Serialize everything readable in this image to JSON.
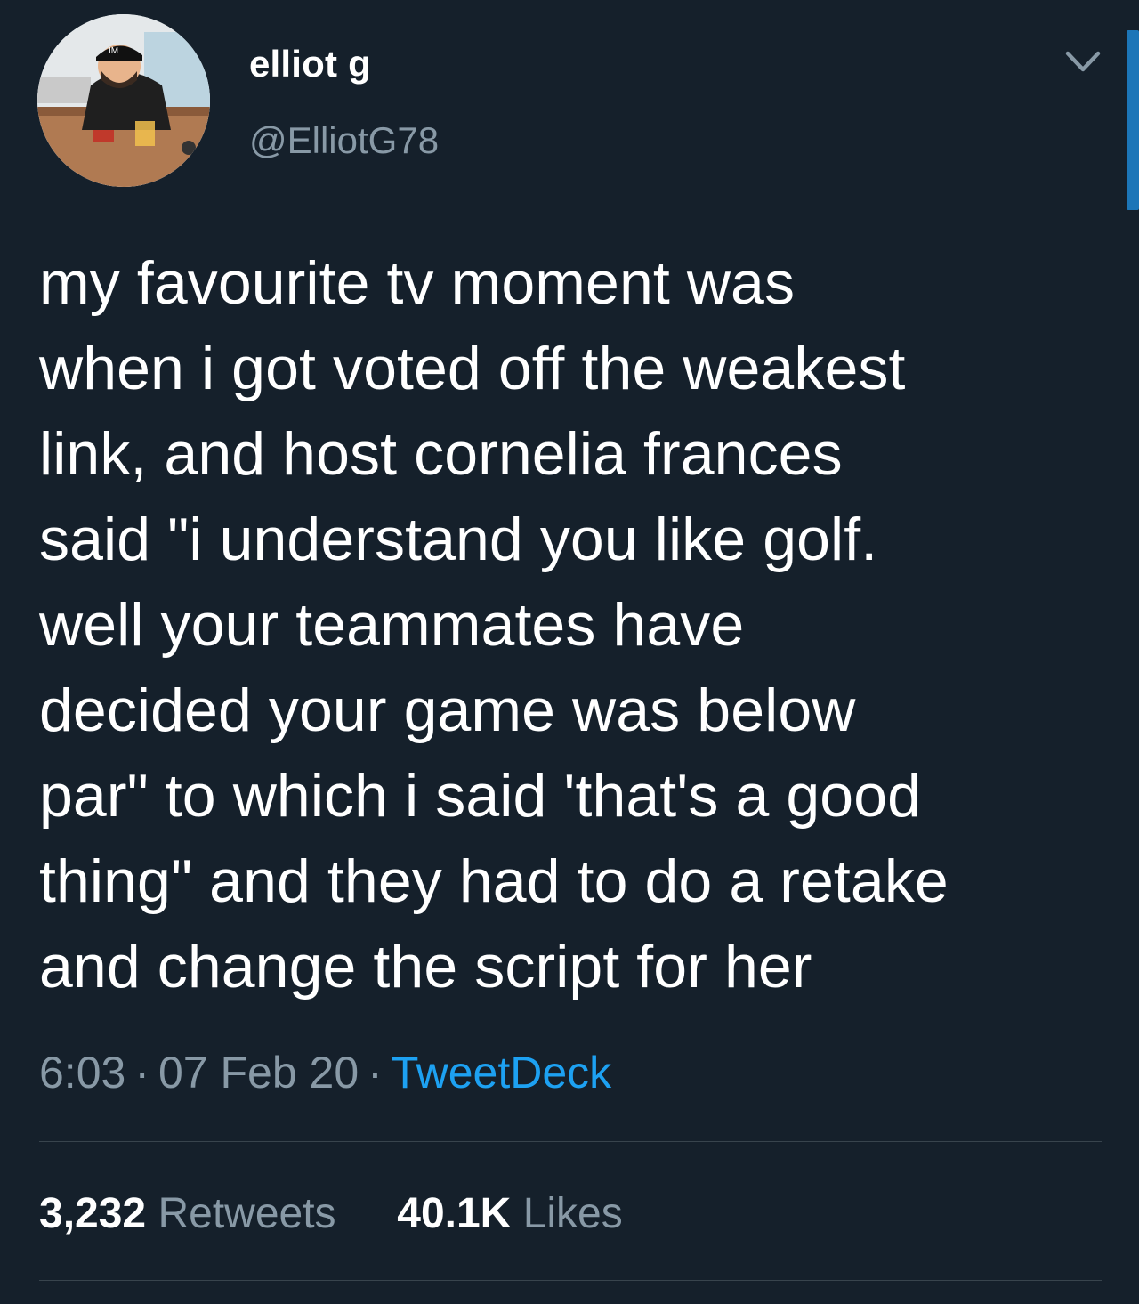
{
  "tweet": {
    "author": {
      "display_name": "elliot g",
      "handle": "@ElliotG78",
      "avatar_icon": "user-avatar-cartoon",
      "avatar_cap_text": "IM"
    },
    "menu_icon": "chevron-down-icon",
    "text": "my favourite tv moment was\nwhen i got voted off the weakest\nlink, and host cornelia frances\nsaid \"i understand you like golf.\nwell your teammates have\ndecided your game was below\npar\" to which i said 'that's a good\nthing\" and they had to do a retake\nand change the script for her",
    "time": "6:03",
    "separator": "·",
    "date": "07 Feb 20",
    "source": "TweetDeck",
    "stats": {
      "retweets_count": "3,232",
      "retweets_label": "Retweets",
      "likes_count": "40.1K",
      "likes_label": "Likes"
    }
  },
  "colors": {
    "background": "#15202b",
    "text_primary": "#ffffff",
    "text_secondary": "#8899a6",
    "accent": "#1da1f2",
    "divider": "#38444d"
  }
}
